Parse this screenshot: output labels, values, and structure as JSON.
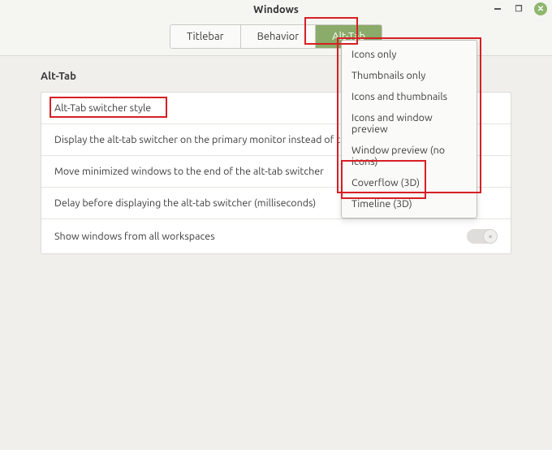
{
  "titlebar": {
    "title": "Windows"
  },
  "tabs": [
    {
      "label": "Titlebar"
    },
    {
      "label": "Behavior"
    },
    {
      "label": "Alt-Tab"
    }
  ],
  "active_tab_label": "Alt-Tab",
  "section_title": "Alt-Tab",
  "rows": [
    {
      "label": "Alt-Tab switcher style"
    },
    {
      "label": "Display the alt-tab switcher on the primary monitor instead of the"
    },
    {
      "label": "Move minimized windows to the end of the alt-tab switcher"
    },
    {
      "label": "Delay before displaying the alt-tab switcher (milliseconds)"
    },
    {
      "label": "Show windows from all workspaces"
    }
  ],
  "toggle_off_glyph": "×",
  "dropdown": {
    "items": [
      "Icons only",
      "Thumbnails only",
      "Icons and thumbnails",
      "Icons and window preview",
      "Window preview (no icons)",
      "Coverflow (3D)",
      "Timeline (3D)"
    ]
  }
}
